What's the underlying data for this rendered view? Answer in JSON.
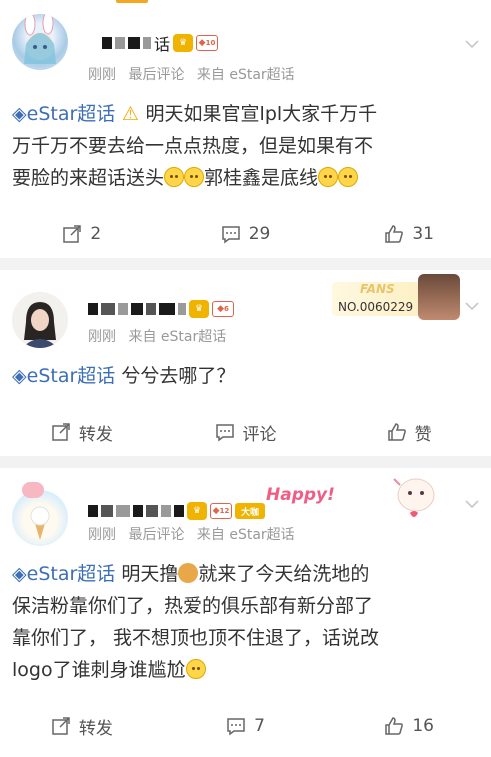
{
  "posts": [
    {
      "name_tail": "话",
      "level": "10",
      "meta": {
        "time": "刚刚",
        "tag": "最后评论",
        "source": "来自 eStar超话"
      },
      "content_lines": [
        [
          "eStar超话",
          " ⚠ ",
          " 明天如果官宣lpl大家千万千"
        ],
        "万千万不要去给一点点热度，但是如果有不",
        "要脸的来超话送头",
        "郭桂鑫是底线"
      ],
      "actions": {
        "repost": "2",
        "comment": "29",
        "like": "31"
      }
    },
    {
      "level": "6",
      "meta": {
        "time": "刚刚",
        "source": "来自 eStar超话"
      },
      "fans": {
        "label": "FANS",
        "number": "NO.0060229"
      },
      "content": {
        "topic": "eStar超话",
        "text": " 兮兮去哪了？"
      },
      "actions": {
        "repost": "转发",
        "comment": "评论",
        "like": "赞"
      }
    },
    {
      "level": "12",
      "big_badge": "大咖",
      "meta": {
        "time": "刚刚",
        "tag": "最后评论",
        "source": "来自 eStar超话"
      },
      "happy": "Happy!",
      "content_lines": [
        [
          "eStar超话",
          " 明天撸",
          "就来了今天给洗地的"
        ],
        "保洁粉靠你们了，热爱的俱乐部有新分部了",
        "靠你们了， 我不想顶也顶不住退了，话说改",
        "logo了谁刺身谁尴尬"
      ],
      "actions": {
        "repost": "转发",
        "comment": "7",
        "like": "16"
      }
    }
  ],
  "colors": {
    "topic": "#3d6fb6",
    "meta": "#999999",
    "accent": "#f5a623",
    "separator": "#f2f2f2"
  },
  "icons": [
    "chevron-down-icon",
    "repost-icon",
    "comment-icon",
    "like-icon",
    "diamond-icon",
    "crown-icon",
    "warning-icon",
    "smile-emoji-icon"
  ]
}
